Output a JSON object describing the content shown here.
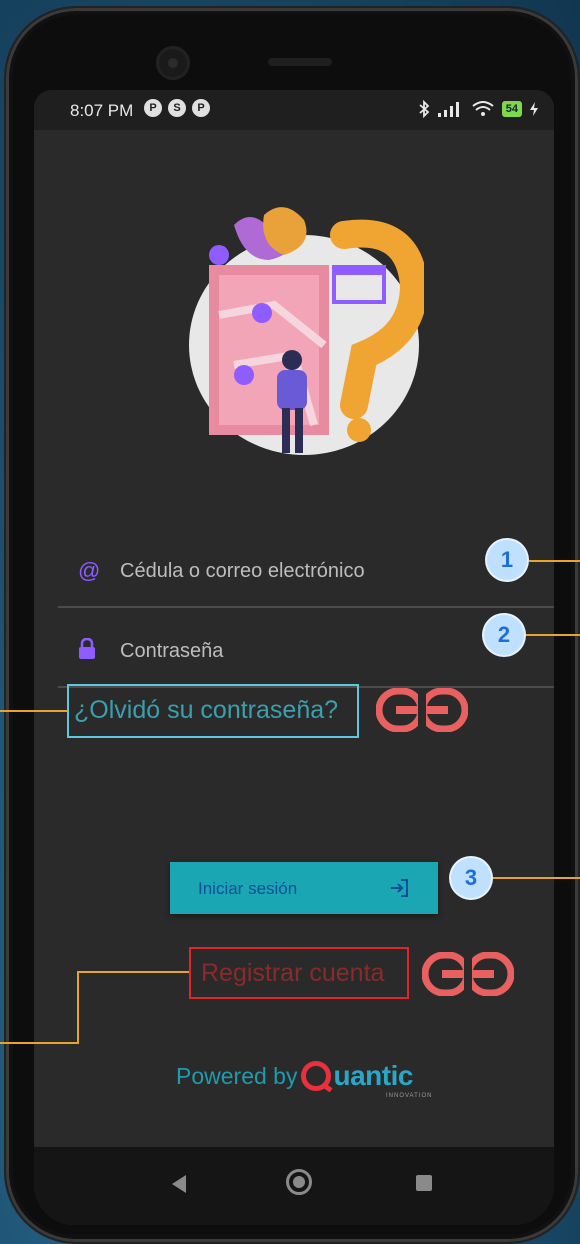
{
  "status_bar": {
    "time": "8:07 PM",
    "notification_icons": [
      "P",
      "S",
      "P"
    ],
    "battery": "54"
  },
  "login_form": {
    "email_placeholder": "Cédula o correo electrónico",
    "password_placeholder": "Contraseña",
    "forgot_password_link": "¿Olvidó su contraseña?",
    "login_button": "Iniciar sesión",
    "register_link": "Registrar cuenta"
  },
  "footer": {
    "powered_by": "Powered by",
    "brand": "uantic",
    "brand_tagline": "INNOVATION"
  },
  "annotations": {
    "callouts": [
      "1",
      "2",
      "3"
    ]
  },
  "colors": {
    "accent_purple": "#8e5cff",
    "button_teal": "#1aa6b3",
    "callout_blue": "#1d6fd8",
    "leader_line": "#e8a42a",
    "link_icon_red": "#e86060",
    "forgot_box": "#5fc8dc",
    "register_box": "#e0262b"
  },
  "icons": {
    "email_field": "at-sign-icon",
    "password_field": "lock-icon",
    "login_button": "login-arrow-icon",
    "link_annotation": "chain-link-icon"
  }
}
